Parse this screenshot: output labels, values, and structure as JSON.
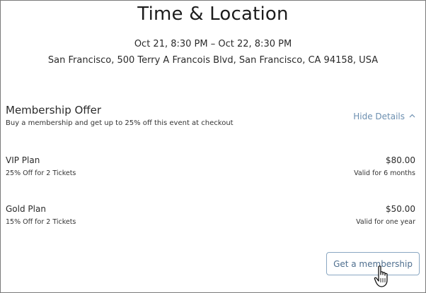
{
  "header": {
    "title": "Time & Location",
    "datetime": "Oct 21, 8:30 PM – Oct 22, 8:30 PM",
    "address": "San Francisco, 500 Terry A Francois Blvd, San Francisco, CA 94158, USA"
  },
  "membership": {
    "title": "Membership Offer",
    "description": "Buy a membership and get up to 25% off this event at checkout",
    "toggle_label": "Hide Details",
    "toggle_icon": "chevron-up-icon",
    "plans": [
      {
        "name": "VIP Plan",
        "discount": "25% Off for 2 Tickets",
        "price": "$80.00",
        "validity": "Valid for 6 months"
      },
      {
        "name": "Gold Plan",
        "discount": "15% Off for 2 Tickets",
        "price": "$50.00",
        "validity": "Valid for one year"
      }
    ],
    "cta_label": "Get a membership"
  },
  "colors": {
    "link": "#6c8fb0",
    "button_border": "#8aa7c2",
    "button_text": "#4f6f8f"
  },
  "cursor_icon": "hand-pointer-icon"
}
